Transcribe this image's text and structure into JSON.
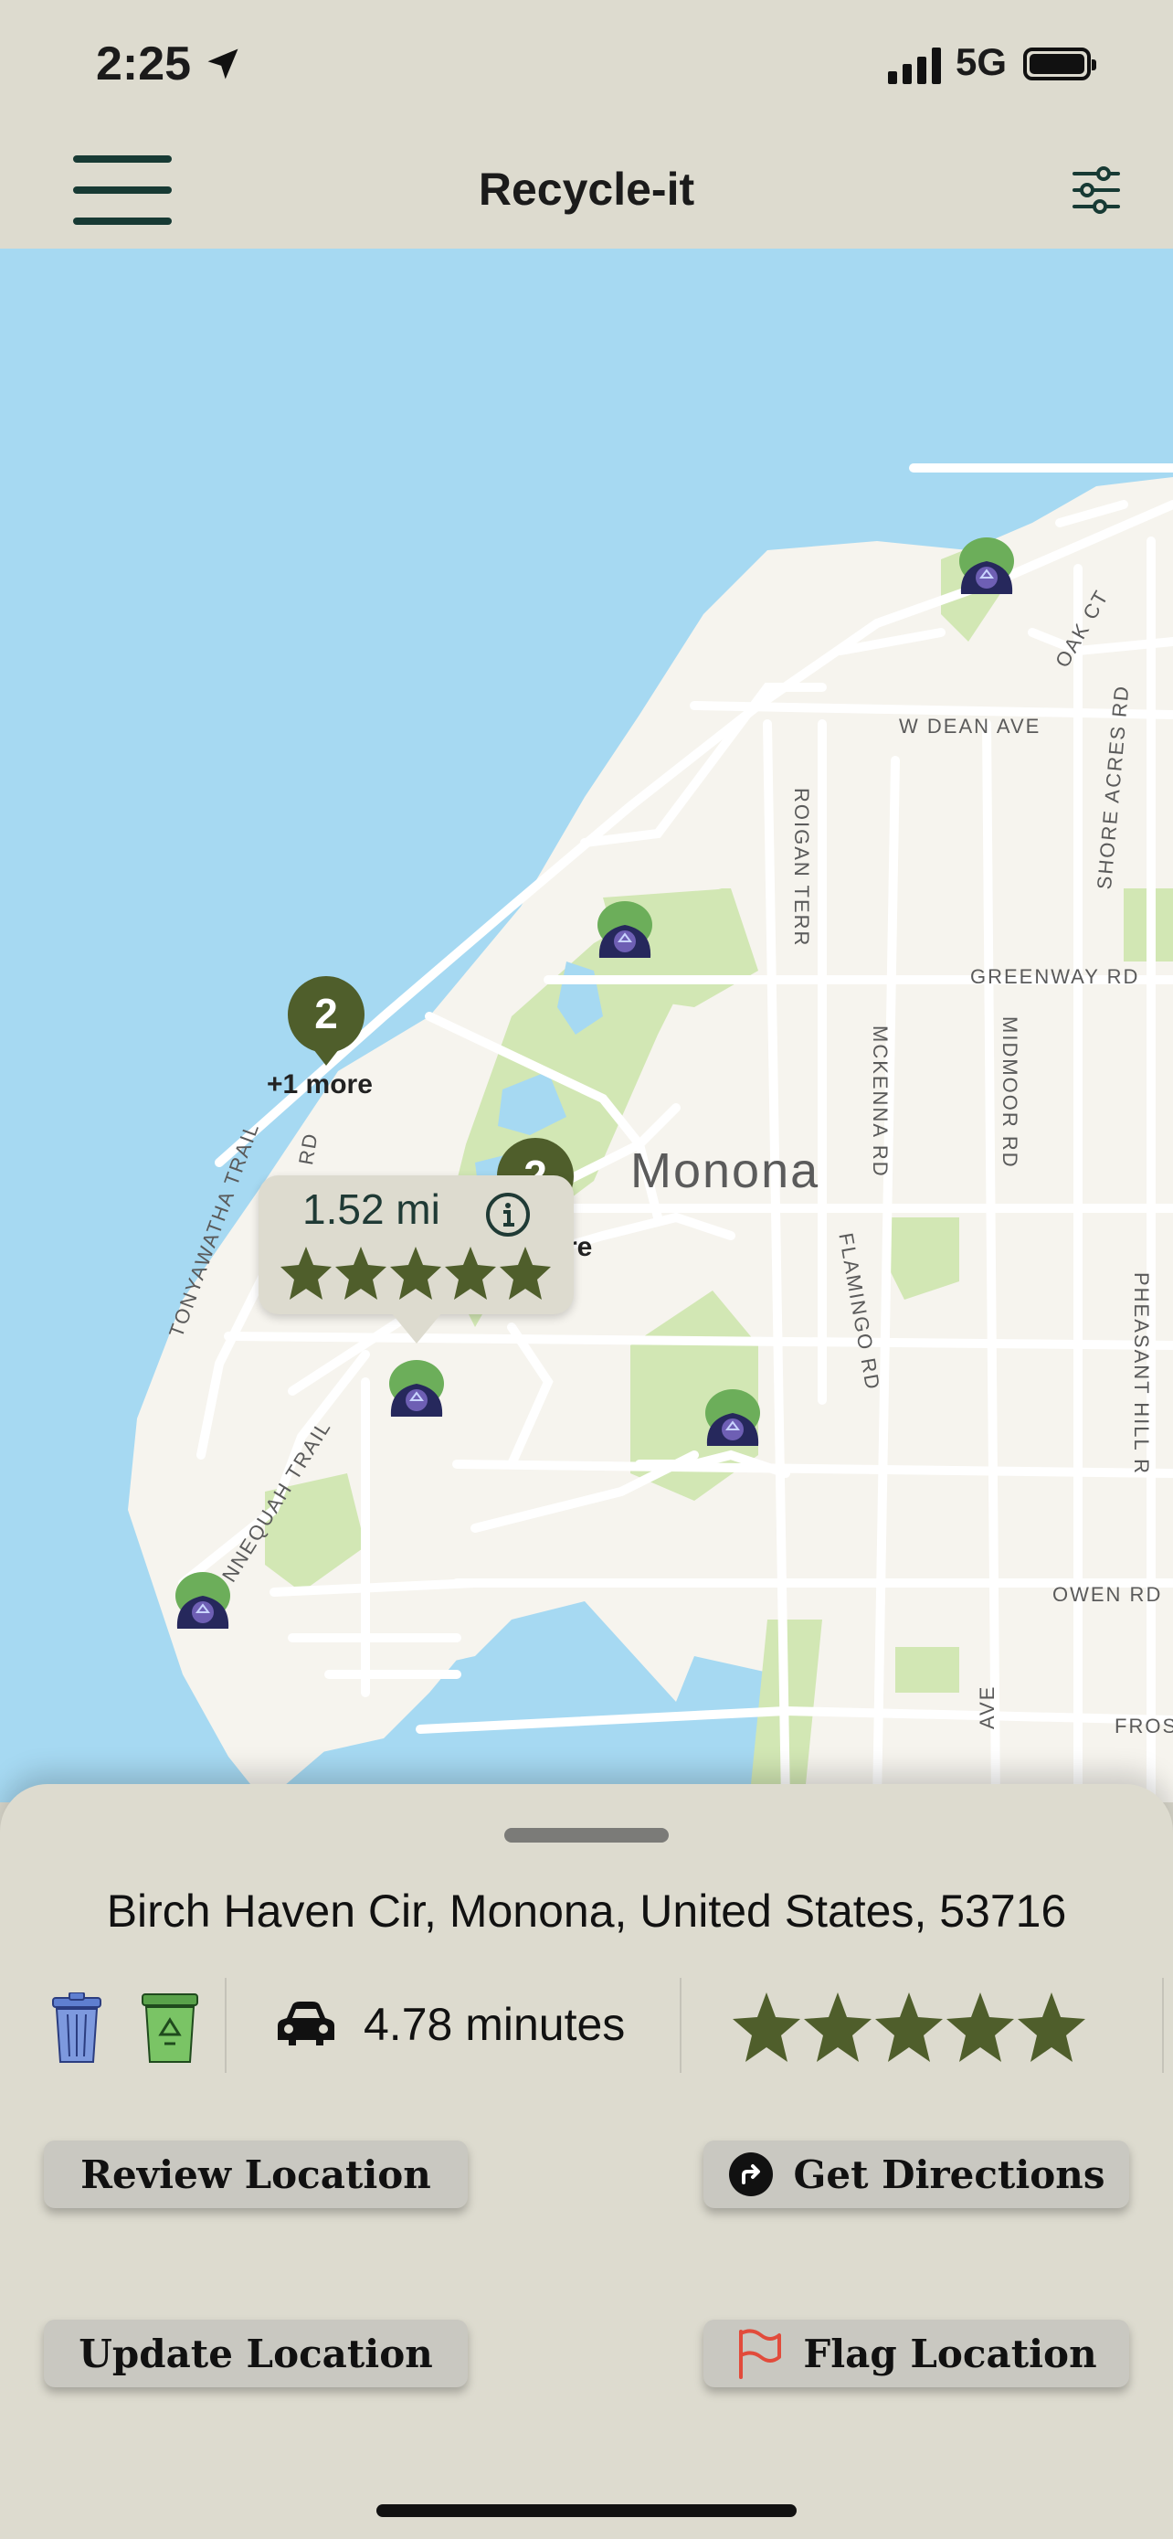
{
  "status_bar": {
    "time": "2:25",
    "network": "5G"
  },
  "nav": {
    "title": "Recycle-it"
  },
  "map": {
    "town_label": "Monona",
    "street_labels": {
      "w_dean_ave": "W DEAN AVE",
      "oak_ct": "OAK CT",
      "shore_acres_rd": "SHORE ACRES RD",
      "roigan_terr": "ROIGAN TERR",
      "greenway_rd": "GREENWAY RD",
      "mckenna_rd": "MCKENNA RD",
      "midmoor_rd": "MIDMOOR RD",
      "flamingo_rd": "FLAMINGO RD",
      "pheasant_hill_rd": "PHEASANT HILL R",
      "owen_rd": "OWEN RD",
      "fros": "FROS",
      "ave": "AVE",
      "tonyawatha_trail": "TONYAWATHA TRAIL",
      "nnequah_trail": "NNEQUAH TRAIL",
      "rd_fragment": "RD"
    },
    "clusters": [
      {
        "count": "2",
        "more_label": "+1 more"
      },
      {
        "count": "2",
        "more_label": "re"
      }
    ],
    "callout": {
      "distance": "1.52 mi",
      "rating": 5
    }
  },
  "sheet": {
    "address": "Birch Haven Cir, Monona, United States, 53716",
    "drive_time": "4.78 minutes",
    "rating": 5,
    "buttons": {
      "review": "Review Location",
      "directions": "Get Directions",
      "update": "Update Location",
      "flag": "Flag Location"
    }
  },
  "colors": {
    "background": "#dddbcf",
    "accent_olive": "#4f5e2b",
    "water": "#a6d9f2",
    "land": "#f6f4ee",
    "park": "#d2e7b4",
    "flag_red": "#e24b3b"
  },
  "icons": [
    "menu-icon",
    "filter-icon",
    "location-arrow-icon",
    "info-icon",
    "trash-bin-icon",
    "recycle-bin-icon",
    "car-icon",
    "directions-icon",
    "flag-icon",
    "star-icon",
    "recycle-location-pin-icon"
  ]
}
